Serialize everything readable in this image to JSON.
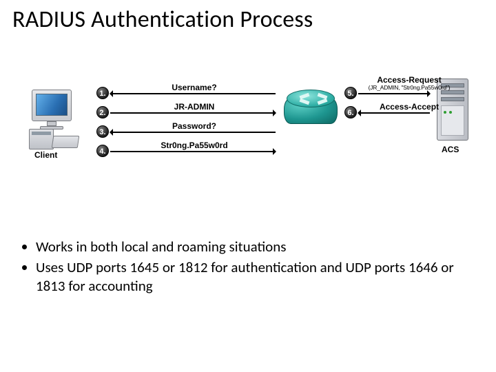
{
  "title": "RADIUS Authentication Process",
  "devices": {
    "client_label": "Client",
    "server_label": "ACS"
  },
  "sequence": {
    "s1": {
      "num": "1.",
      "label": "Username?"
    },
    "s2": {
      "num": "2.",
      "label": "JR-ADMIN"
    },
    "s3": {
      "num": "3.",
      "label": "Password?"
    },
    "s4": {
      "num": "4.",
      "label": "Str0ng.Pa55w0rd"
    },
    "s5": {
      "num": "5.",
      "label": "Access-Request",
      "sub": "(JR_ADMIN, \"Str0ng.Pa55w0rd\")"
    },
    "s6": {
      "num": "6.",
      "label": "Access-Accept"
    }
  },
  "bullets": [
    "Works in both local and roaming situations",
    "Uses UDP ports 1645 or 1812 for authentication and UDP ports 1646 or 1813 for accounting"
  ]
}
